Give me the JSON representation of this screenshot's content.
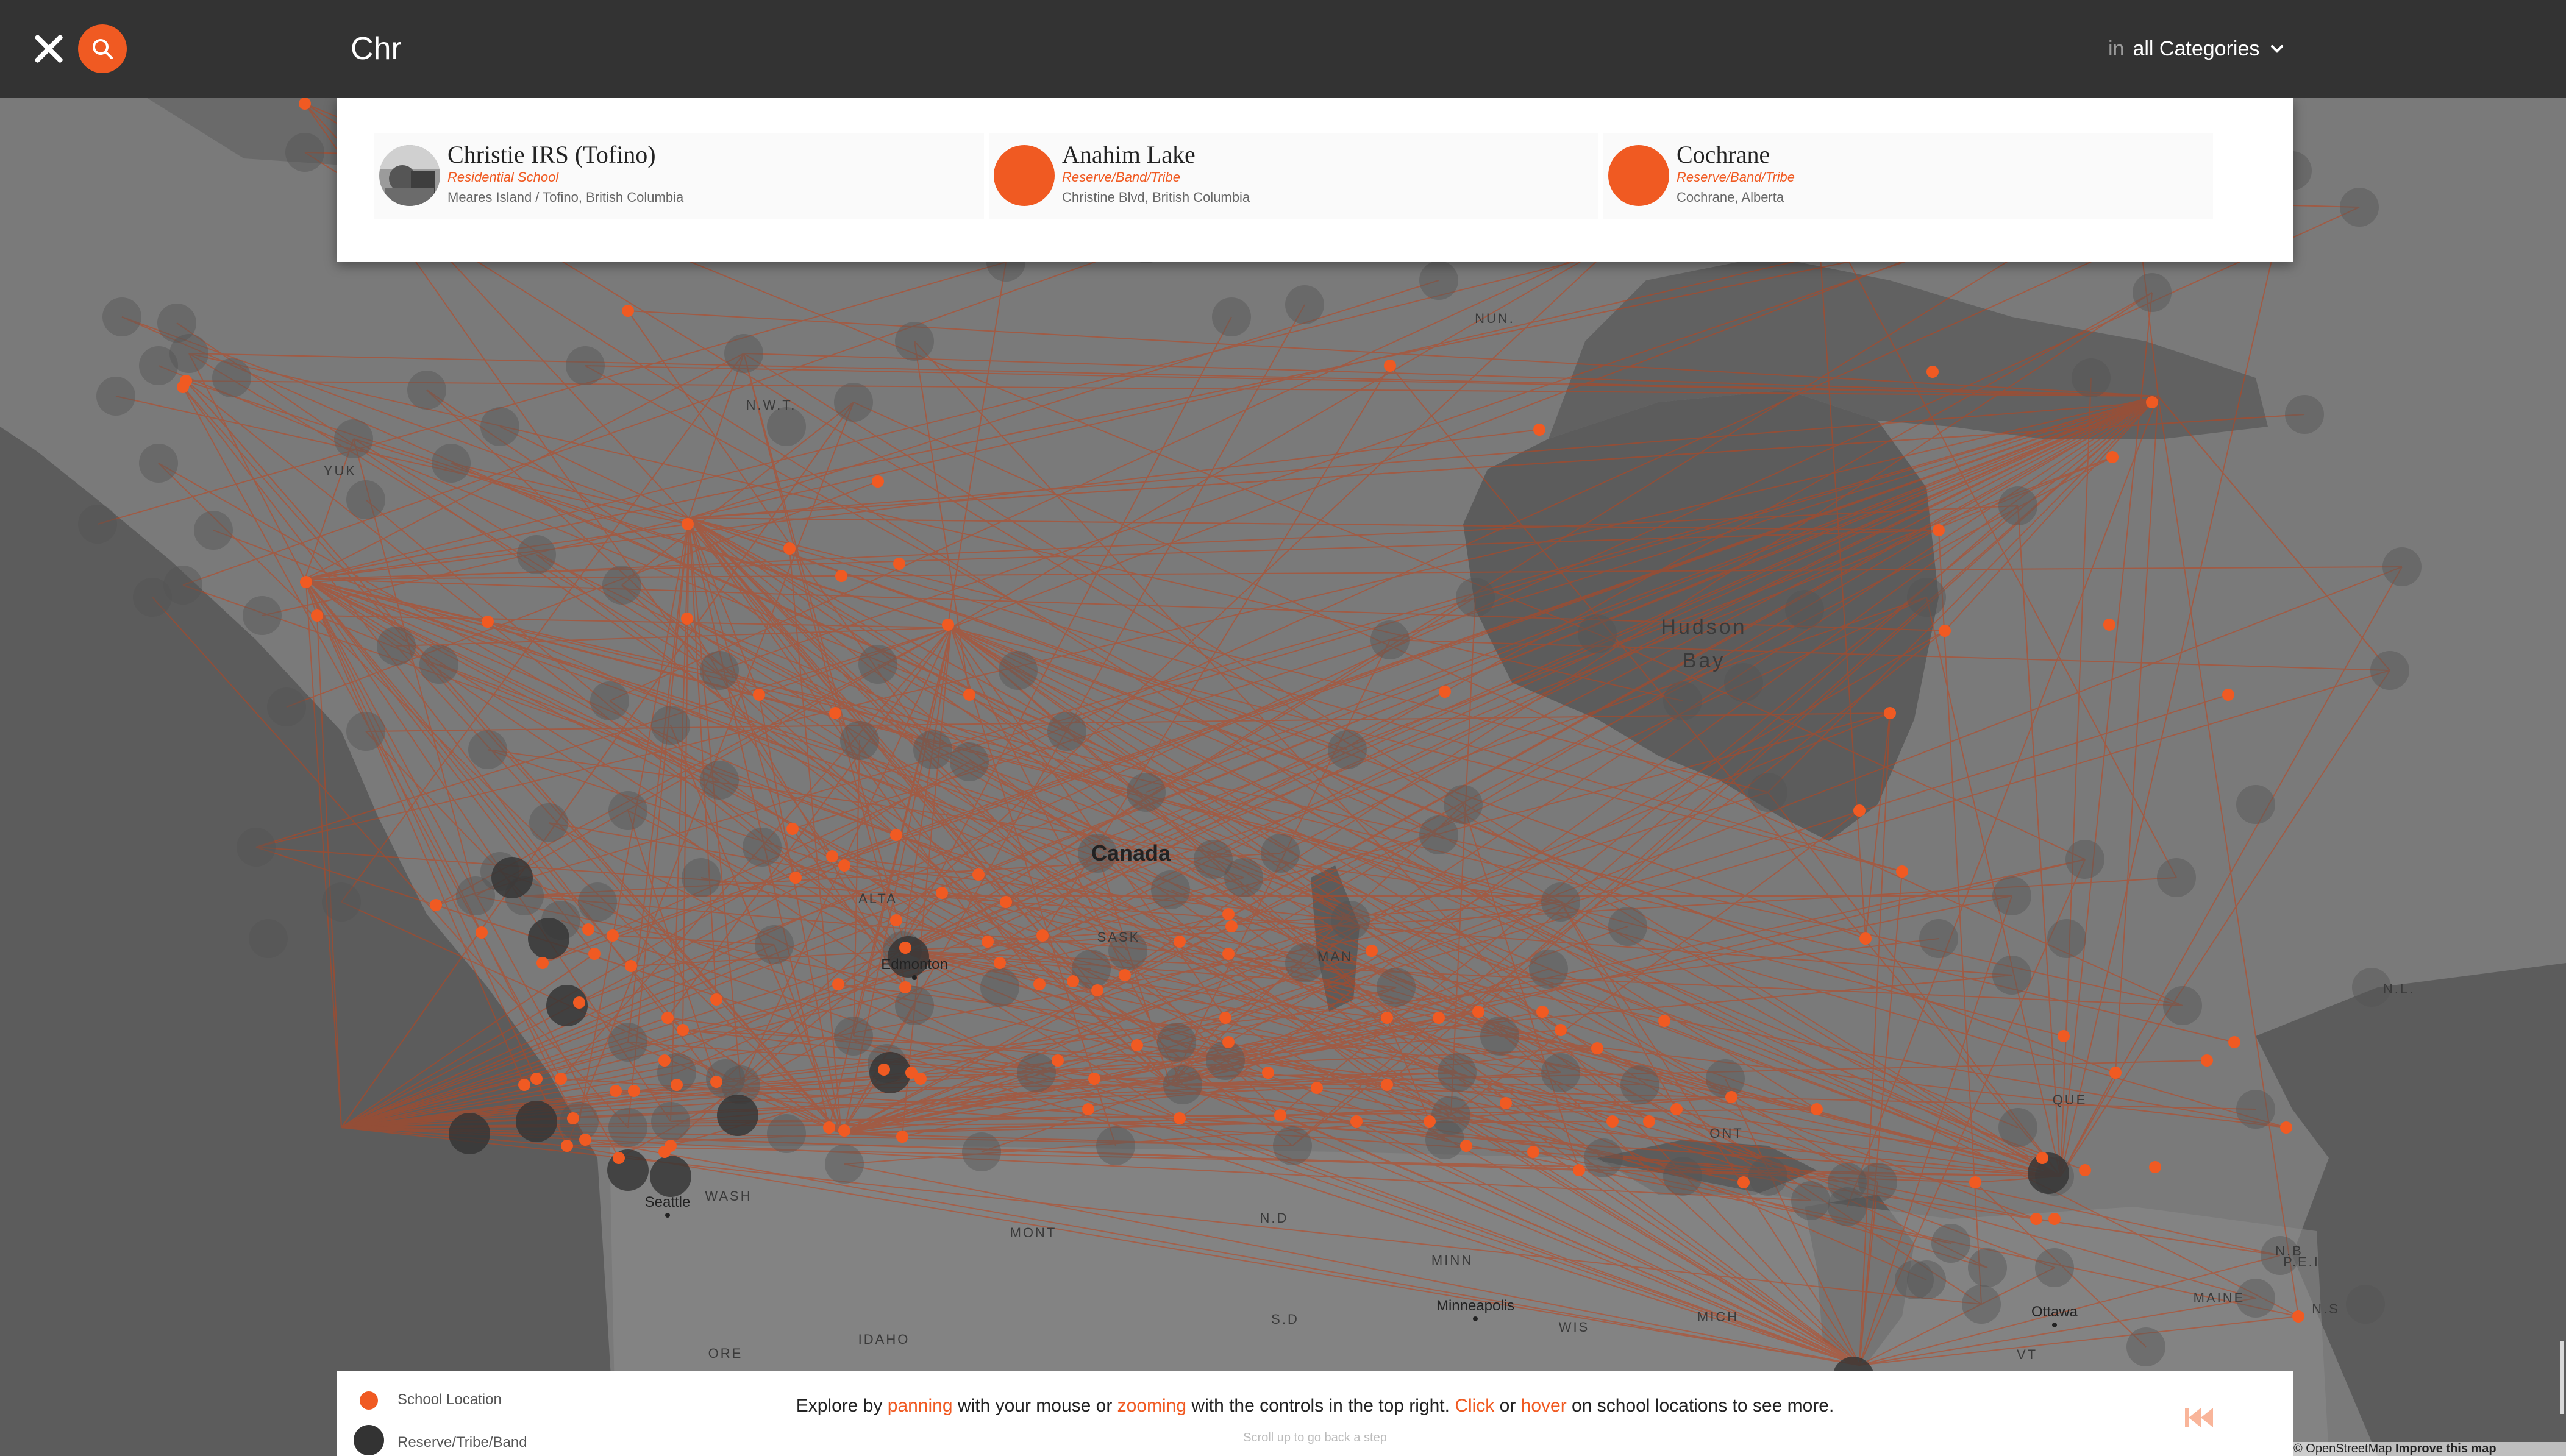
{
  "search": {
    "query": "Chr",
    "in_label": "in",
    "category_selected": "all Categories"
  },
  "icons": {
    "close": "close-icon",
    "search": "search-icon",
    "chevron": "chevron-down-icon",
    "rewind": "rewind-icon"
  },
  "colors": {
    "accent": "#f05a22",
    "topbar": "#333333",
    "reserve": "#333333",
    "land": "#767676",
    "water": "#5c5c5c"
  },
  "results": [
    {
      "name": "Christie IRS (Tofino)",
      "category": "Residential School",
      "location": "Meares Island / Tofino, British Columbia",
      "thumb": "photo"
    },
    {
      "name": "Anahim Lake",
      "category": "Reserve/Band/Tribe",
      "location": "Christine Blvd, British Columbia",
      "thumb": "dot"
    },
    {
      "name": "Cochrane",
      "category": "Reserve/Band/Tribe",
      "location": "Cochrane, Alberta",
      "thumb": "dot"
    }
  ],
  "map_labels": {
    "country": "Canada",
    "water": [
      "Hudson",
      "Bay"
    ],
    "provinces": [
      "N.W.T.",
      "YUK",
      "NUN.",
      "ALTA",
      "SASK",
      "MAN",
      "ONT",
      "QUE",
      "N.L.",
      "WASH",
      "MONT",
      "N.D",
      "MINN",
      "S.D",
      "IDAHO",
      "ORE",
      "WIS",
      "MICH",
      "VT",
      "MAINE",
      "N.B",
      "P.E.I",
      "N.S"
    ],
    "cities": [
      "Edmonton",
      "Seattle",
      "Minneapolis",
      "Ottawa"
    ]
  },
  "legend": {
    "school": "School Location",
    "reserve": "Reserve/Tribe/Band"
  },
  "instructions": {
    "part1": "Explore by ",
    "panning": "panning",
    "part2": " with your mouse or ",
    "zooming": "zooming",
    "part3": " with the controls in the top right. ",
    "click": "Click",
    "part4": " or ",
    "hover": "hover",
    "part5": " on school locations to see more."
  },
  "scroll_hint": "Scroll up to go back a step",
  "attribution": {
    "osm": "© OpenStreetMap",
    "improve": "Improve this map"
  }
}
